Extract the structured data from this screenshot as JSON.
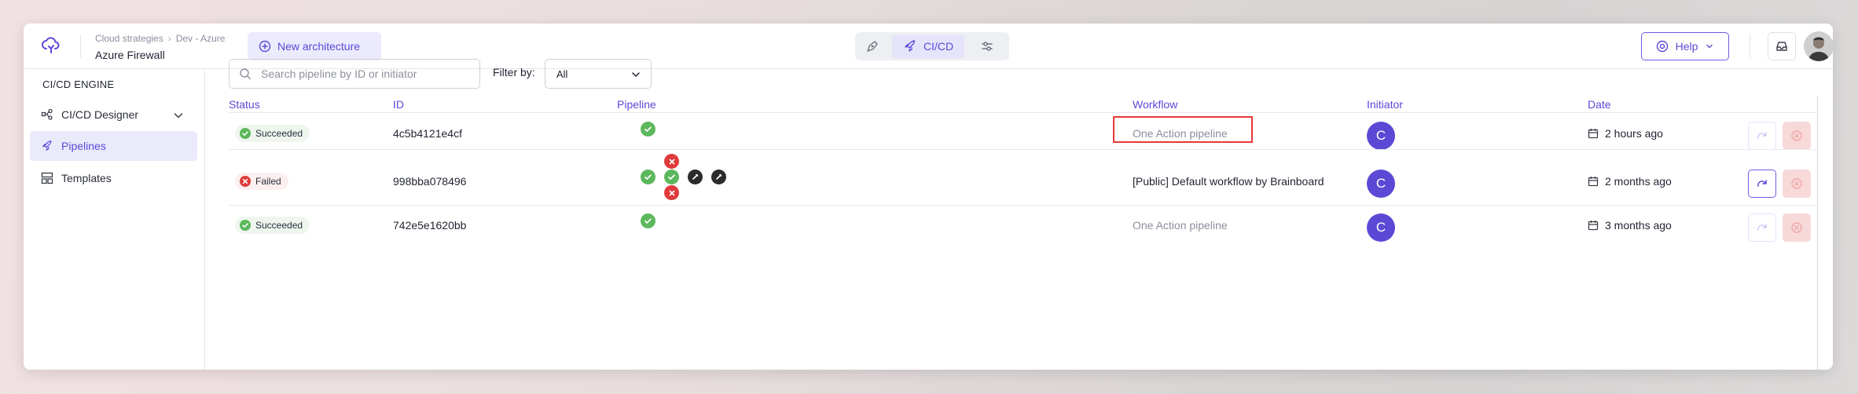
{
  "breadcrumb": {
    "parent": "Cloud strategies",
    "child": "Dev - Azure"
  },
  "project_name": "Azure Firewall",
  "new_architecture_label": "New architecture",
  "mode_switch": {
    "active_label": "CI/CD"
  },
  "help_label": "Help",
  "sidebar": {
    "title": "CI/CD ENGINE",
    "items": [
      {
        "label": "CI/CD Designer"
      },
      {
        "label": "Pipelines"
      },
      {
        "label": "Templates"
      }
    ]
  },
  "search": {
    "placeholder": "Search pipeline by ID or initiator",
    "value": ""
  },
  "filter": {
    "label": "Filter by:",
    "selected": "All"
  },
  "table": {
    "columns": {
      "status": "Status",
      "id": "ID",
      "pipeline": "Pipeline",
      "workflow": "Workflow",
      "initiator": "Initiator",
      "date": "Date"
    },
    "rows": [
      {
        "status": "Succeeded",
        "id": "4c5b4121e4cf",
        "pipeline": [
          "success"
        ],
        "workflow": "One Action pipeline",
        "initiator": "C",
        "date": "2 hours ago"
      },
      {
        "status": "Failed",
        "id": "998bba078496",
        "pipeline": [
          "success",
          "success",
          "skipped",
          "skipped",
          "failed",
          "failed"
        ],
        "workflow": "[Public] Default workflow by Brainboard",
        "initiator": "C",
        "date": "2 months ago"
      },
      {
        "status": "Succeeded",
        "id": "742e5e1620bb",
        "pipeline": [
          "success"
        ],
        "workflow": "One Action pipeline",
        "initiator": "C",
        "date": "3 months ago"
      }
    ]
  },
  "colors": {
    "accent": "#5b49d6",
    "success": "#5cb85c",
    "error": "#e03a3a",
    "highlight": "#e53935"
  },
  "icons": [
    "cloud-logo-icon",
    "plus-circle-icon",
    "pen-tool-icon",
    "rocket-icon",
    "sliders-icon",
    "help-circle-icon",
    "inbox-icon",
    "workflow-icon",
    "chevron-down-icon",
    "template-icon",
    "search-icon",
    "calendar-icon",
    "redo-icon",
    "cancel-icon"
  ]
}
